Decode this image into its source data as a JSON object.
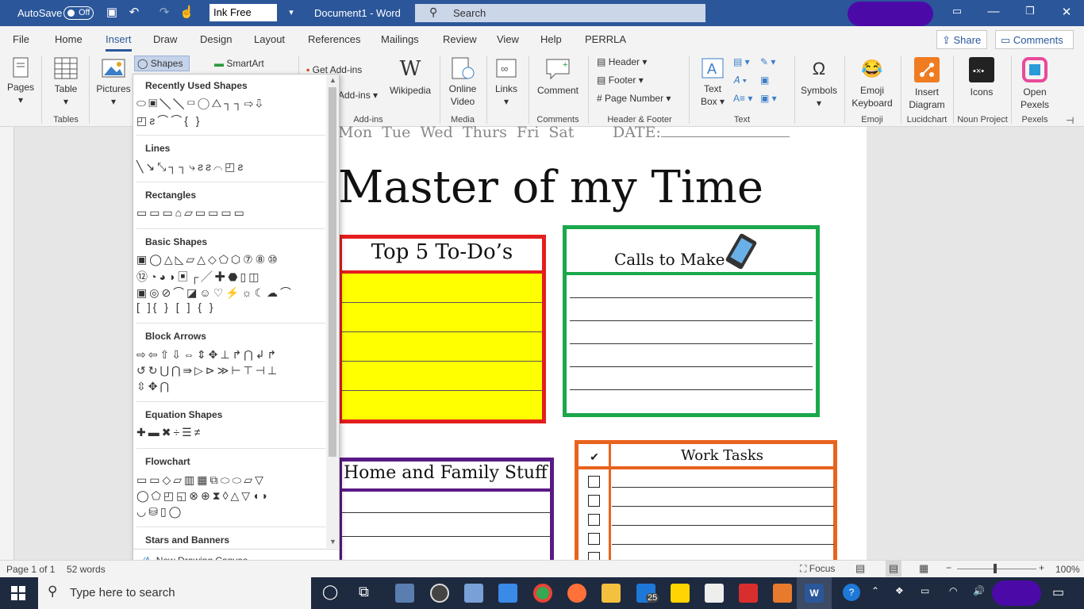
{
  "titlebar": {
    "autosave_label": "AutoSave",
    "autosave_state": "Off",
    "font_box": "Ink Free",
    "doc_title": "Document1 - Word",
    "search_placeholder": "Search"
  },
  "tabs": [
    "File",
    "Home",
    "Insert",
    "Draw",
    "Design",
    "Layout",
    "References",
    "Mailings",
    "Review",
    "View",
    "Help",
    "PERRLA"
  ],
  "share_label": "Share",
  "comments_label": "Comments",
  "ribbon": {
    "pages": "Pages",
    "table": "Table",
    "tables_group": "Tables",
    "pictures": "Pictures",
    "shapes": "Shapes",
    "smartart": "SmartArt",
    "get_addins": "Get Add-ins",
    "addins": "Add-ins",
    "wikipedia": "Wikipedia",
    "addins_group": "Add-ins",
    "online_video_1": "Online",
    "online_video_2": "Video",
    "media_group": "Media",
    "links": "Links",
    "comment": "Comment",
    "comments_group": "Comments",
    "header": "Header",
    "footer": "Footer",
    "page_number": "Page Number",
    "hf_group": "Header & Footer",
    "textbox_1": "Text",
    "textbox_2": "Box",
    "text_group": "Text",
    "symbols": "Symbols",
    "emoji_1": "Emoji",
    "emoji_2": "Keyboard",
    "emoji_group": "Emoji",
    "insdiag_1": "Insert",
    "insdiag_2": "Diagram",
    "lucid_group": "Lucidchart",
    "icons": "Icons",
    "noun_group": "Noun Project",
    "open_1": "Open",
    "open_2": "Pexels",
    "pexels_group": "Pexels"
  },
  "shapes_panel": {
    "recently_used": "Recently Used Shapes",
    "lines": "Lines",
    "rectangles": "Rectangles",
    "basic": "Basic Shapes",
    "block_arrows": "Block Arrows",
    "equation": "Equation Shapes",
    "flowchart": "Flowchart",
    "stars": "Stars and Banners",
    "new_canvas": "New Drawing Canvas"
  },
  "document": {
    "days": "Mon  Tue  Wed  Thurs  Fri  Sat",
    "date_label": "DATE:",
    "title": "Master of my Time",
    "todo_title": "Top 5 To-Do’s",
    "calls_title": "Calls to Make",
    "home_title": "Home and Family Stuff",
    "work_title": "Work Tasks",
    "check_mark": "✔"
  },
  "status": {
    "page": "Page 1 of 1",
    "words": "52 words",
    "focus": "Focus",
    "zoom": "100%"
  },
  "taskbar": {
    "search_placeholder": "Type here to search",
    "mail_badge": "25"
  },
  "colors": {
    "word_blue": "#2b579a",
    "todo_red": "#e41e1e",
    "todo_fill": "#ffff00",
    "calls_green": "#1aa84a",
    "home_purple": "#5a1a86",
    "work_orange": "#e8641e"
  }
}
